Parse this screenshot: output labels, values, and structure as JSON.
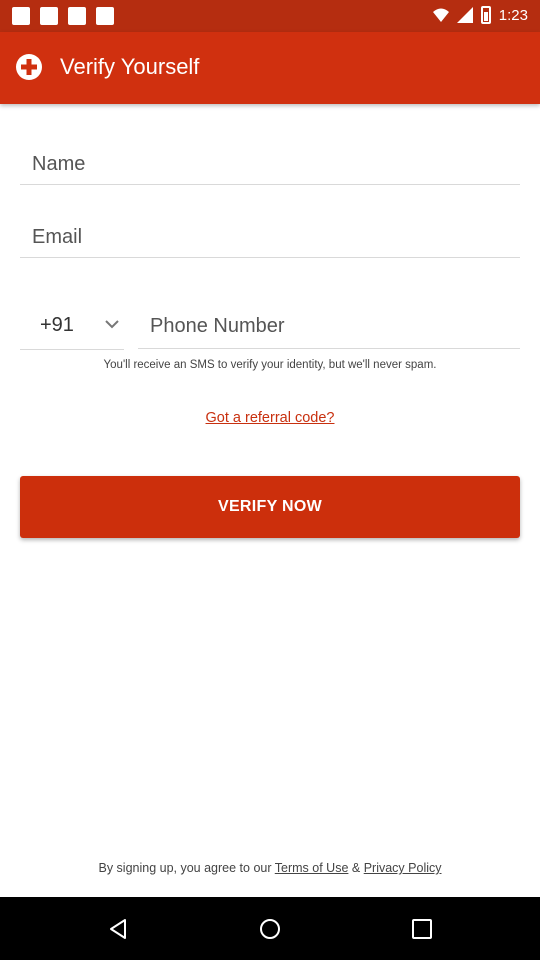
{
  "status_bar": {
    "time": "1:23"
  },
  "app_bar": {
    "title": "Verify Yourself",
    "color": "#d0300f"
  },
  "form": {
    "name_placeholder": "Name",
    "email_placeholder": "Email",
    "country_code": "+91",
    "phone_placeholder": "Phone Number",
    "sms_note": "You'll receive an SMS to verify your identity, but we'll never spam.",
    "referral_link": "Got a referral code?",
    "verify_button": "VERIFY NOW"
  },
  "footer": {
    "prefix": "By signing up, you agree to our ",
    "terms_link": "Terms of Use",
    "amp": " & ",
    "privacy_link": "Privacy Policy"
  },
  "icons": {
    "logo": "plus-cross-icon",
    "chevron": "chevron-down-icon",
    "nav_back": "back-triangle-icon",
    "nav_home": "home-circle-icon",
    "nav_recent": "recent-square-icon"
  }
}
